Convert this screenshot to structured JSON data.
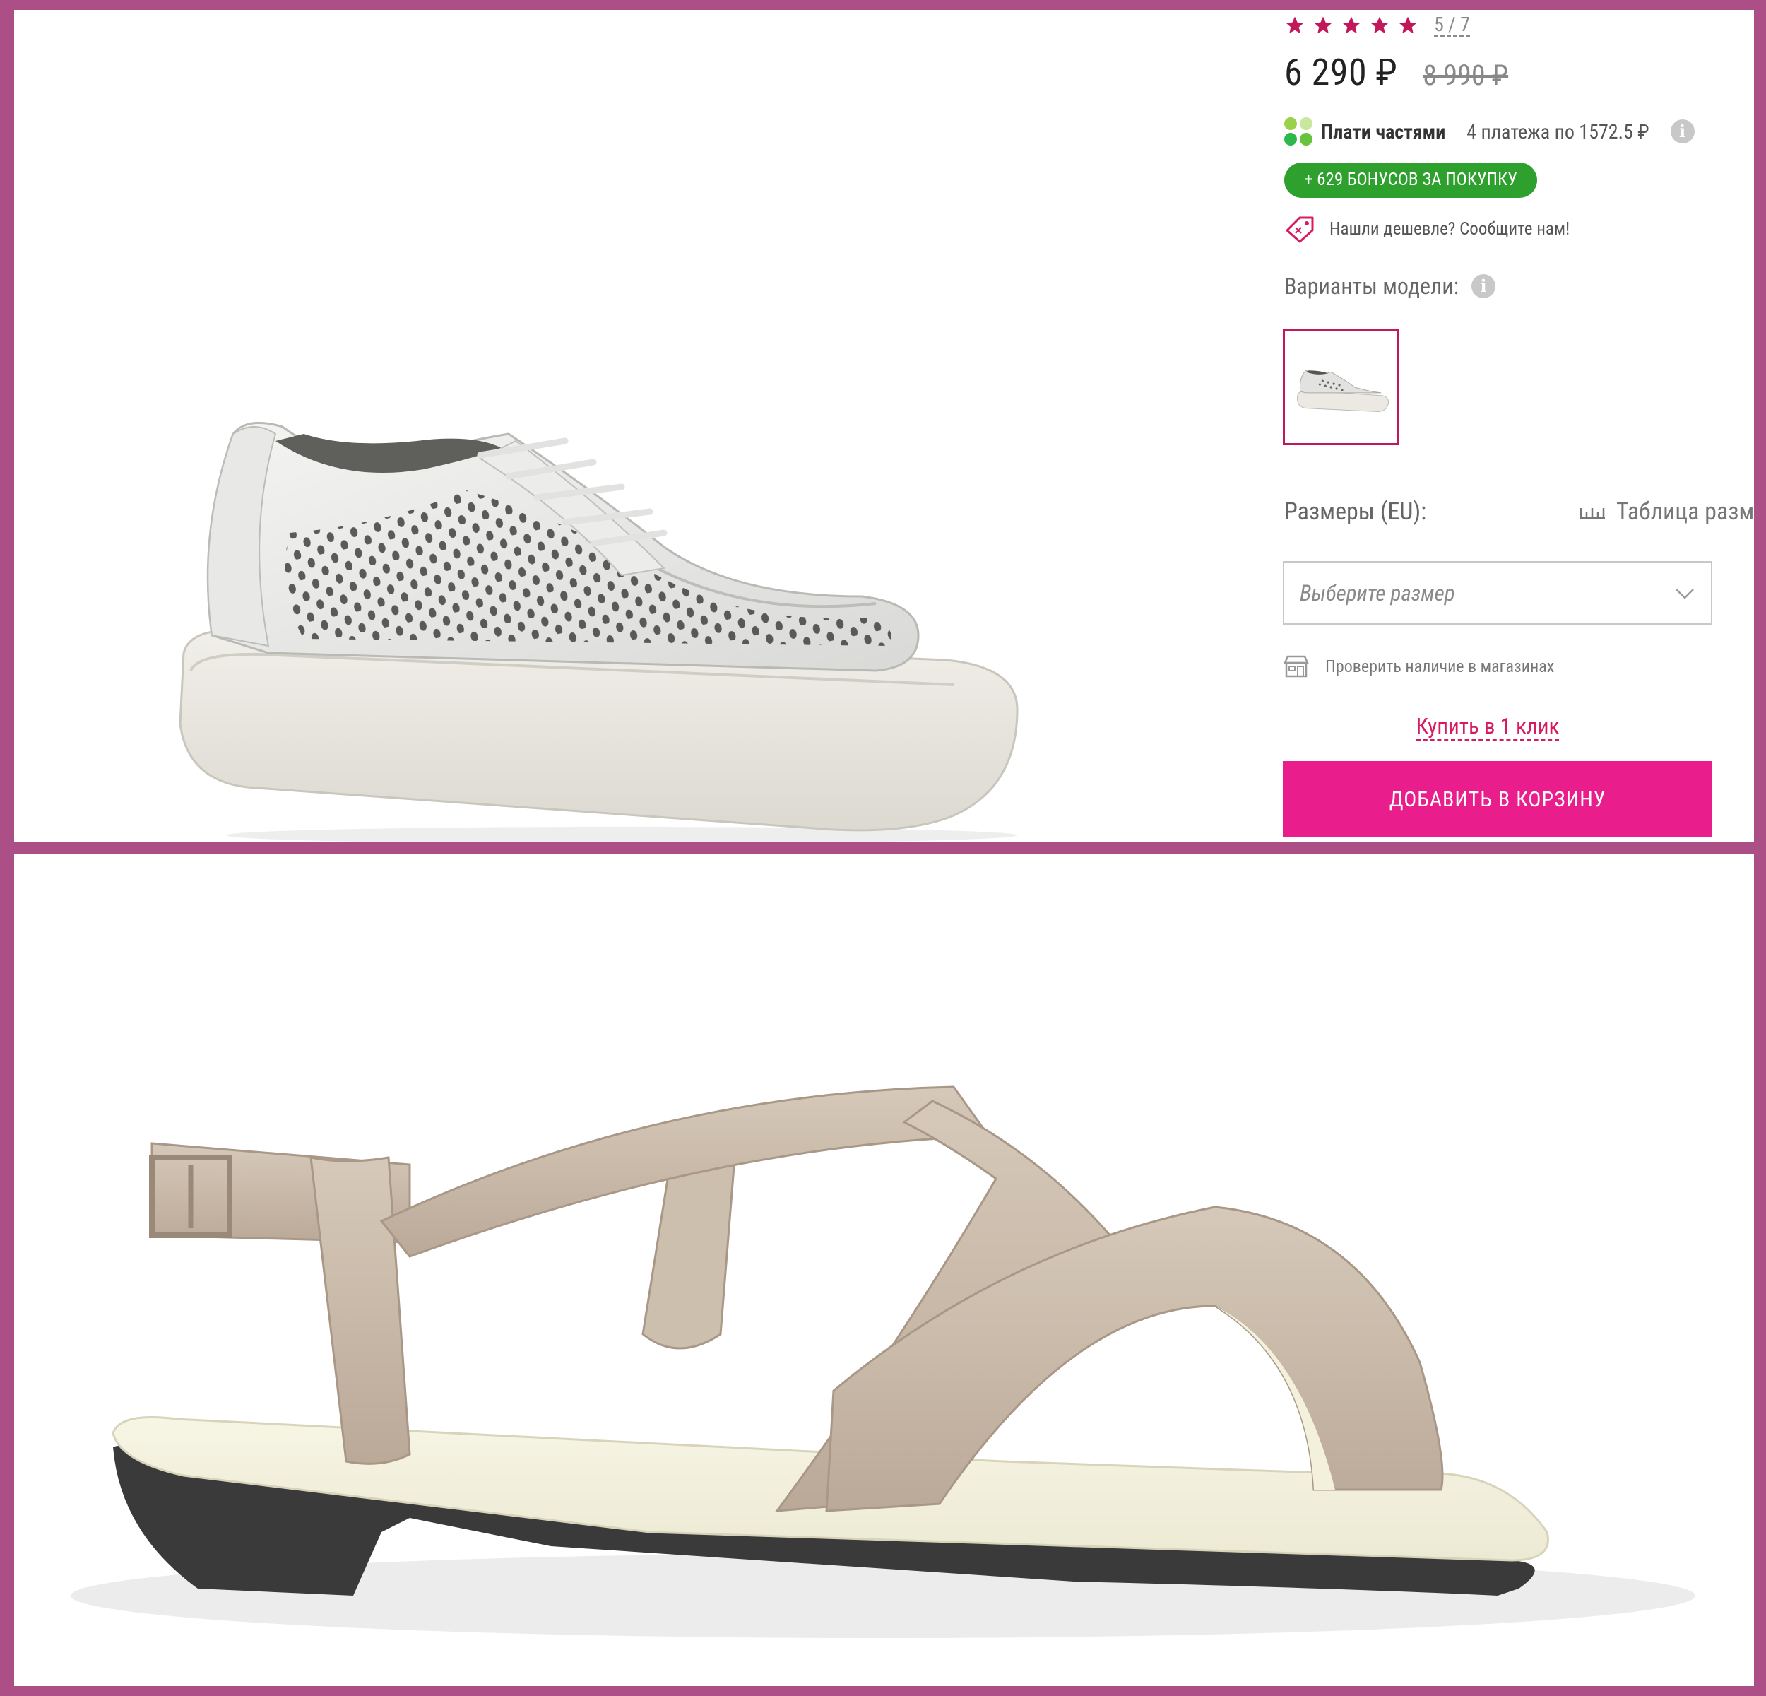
{
  "product": {
    "rating_count": "5 / 7",
    "price_current": "6 290 ₽",
    "price_old": "8 990 ₽",
    "installments": {
      "brand": "Плати частями",
      "detail": "4 платежа по 1572.5 ₽"
    },
    "bonus_badge": "+ 629 БОНУСОВ ЗА ПОКУПКУ",
    "cheaper_link": "Нашли дешевле? Сообщите нам!",
    "variants_label": "Варианты модели:",
    "sizes_label": "Размеры (EU):",
    "size_table_link": "Таблица разме",
    "size_select_placeholder": "Выберите размер",
    "check_stores_link": "Проверить наличие в магазинах",
    "one_click_link": "Купить в 1 клик",
    "add_to_cart_label": "ДОБАВИТЬ В КОРЗИНУ"
  },
  "icons": [
    "star-icon",
    "installments-logo-icon",
    "info-icon",
    "price-tag-icon",
    "ruler-icon",
    "chevron-down-icon",
    "store-icon"
  ],
  "colors": {
    "border": "#ab4f86",
    "accent": "#e91e8c",
    "bonus_green": "#2da02d",
    "link": "#d81b60"
  }
}
